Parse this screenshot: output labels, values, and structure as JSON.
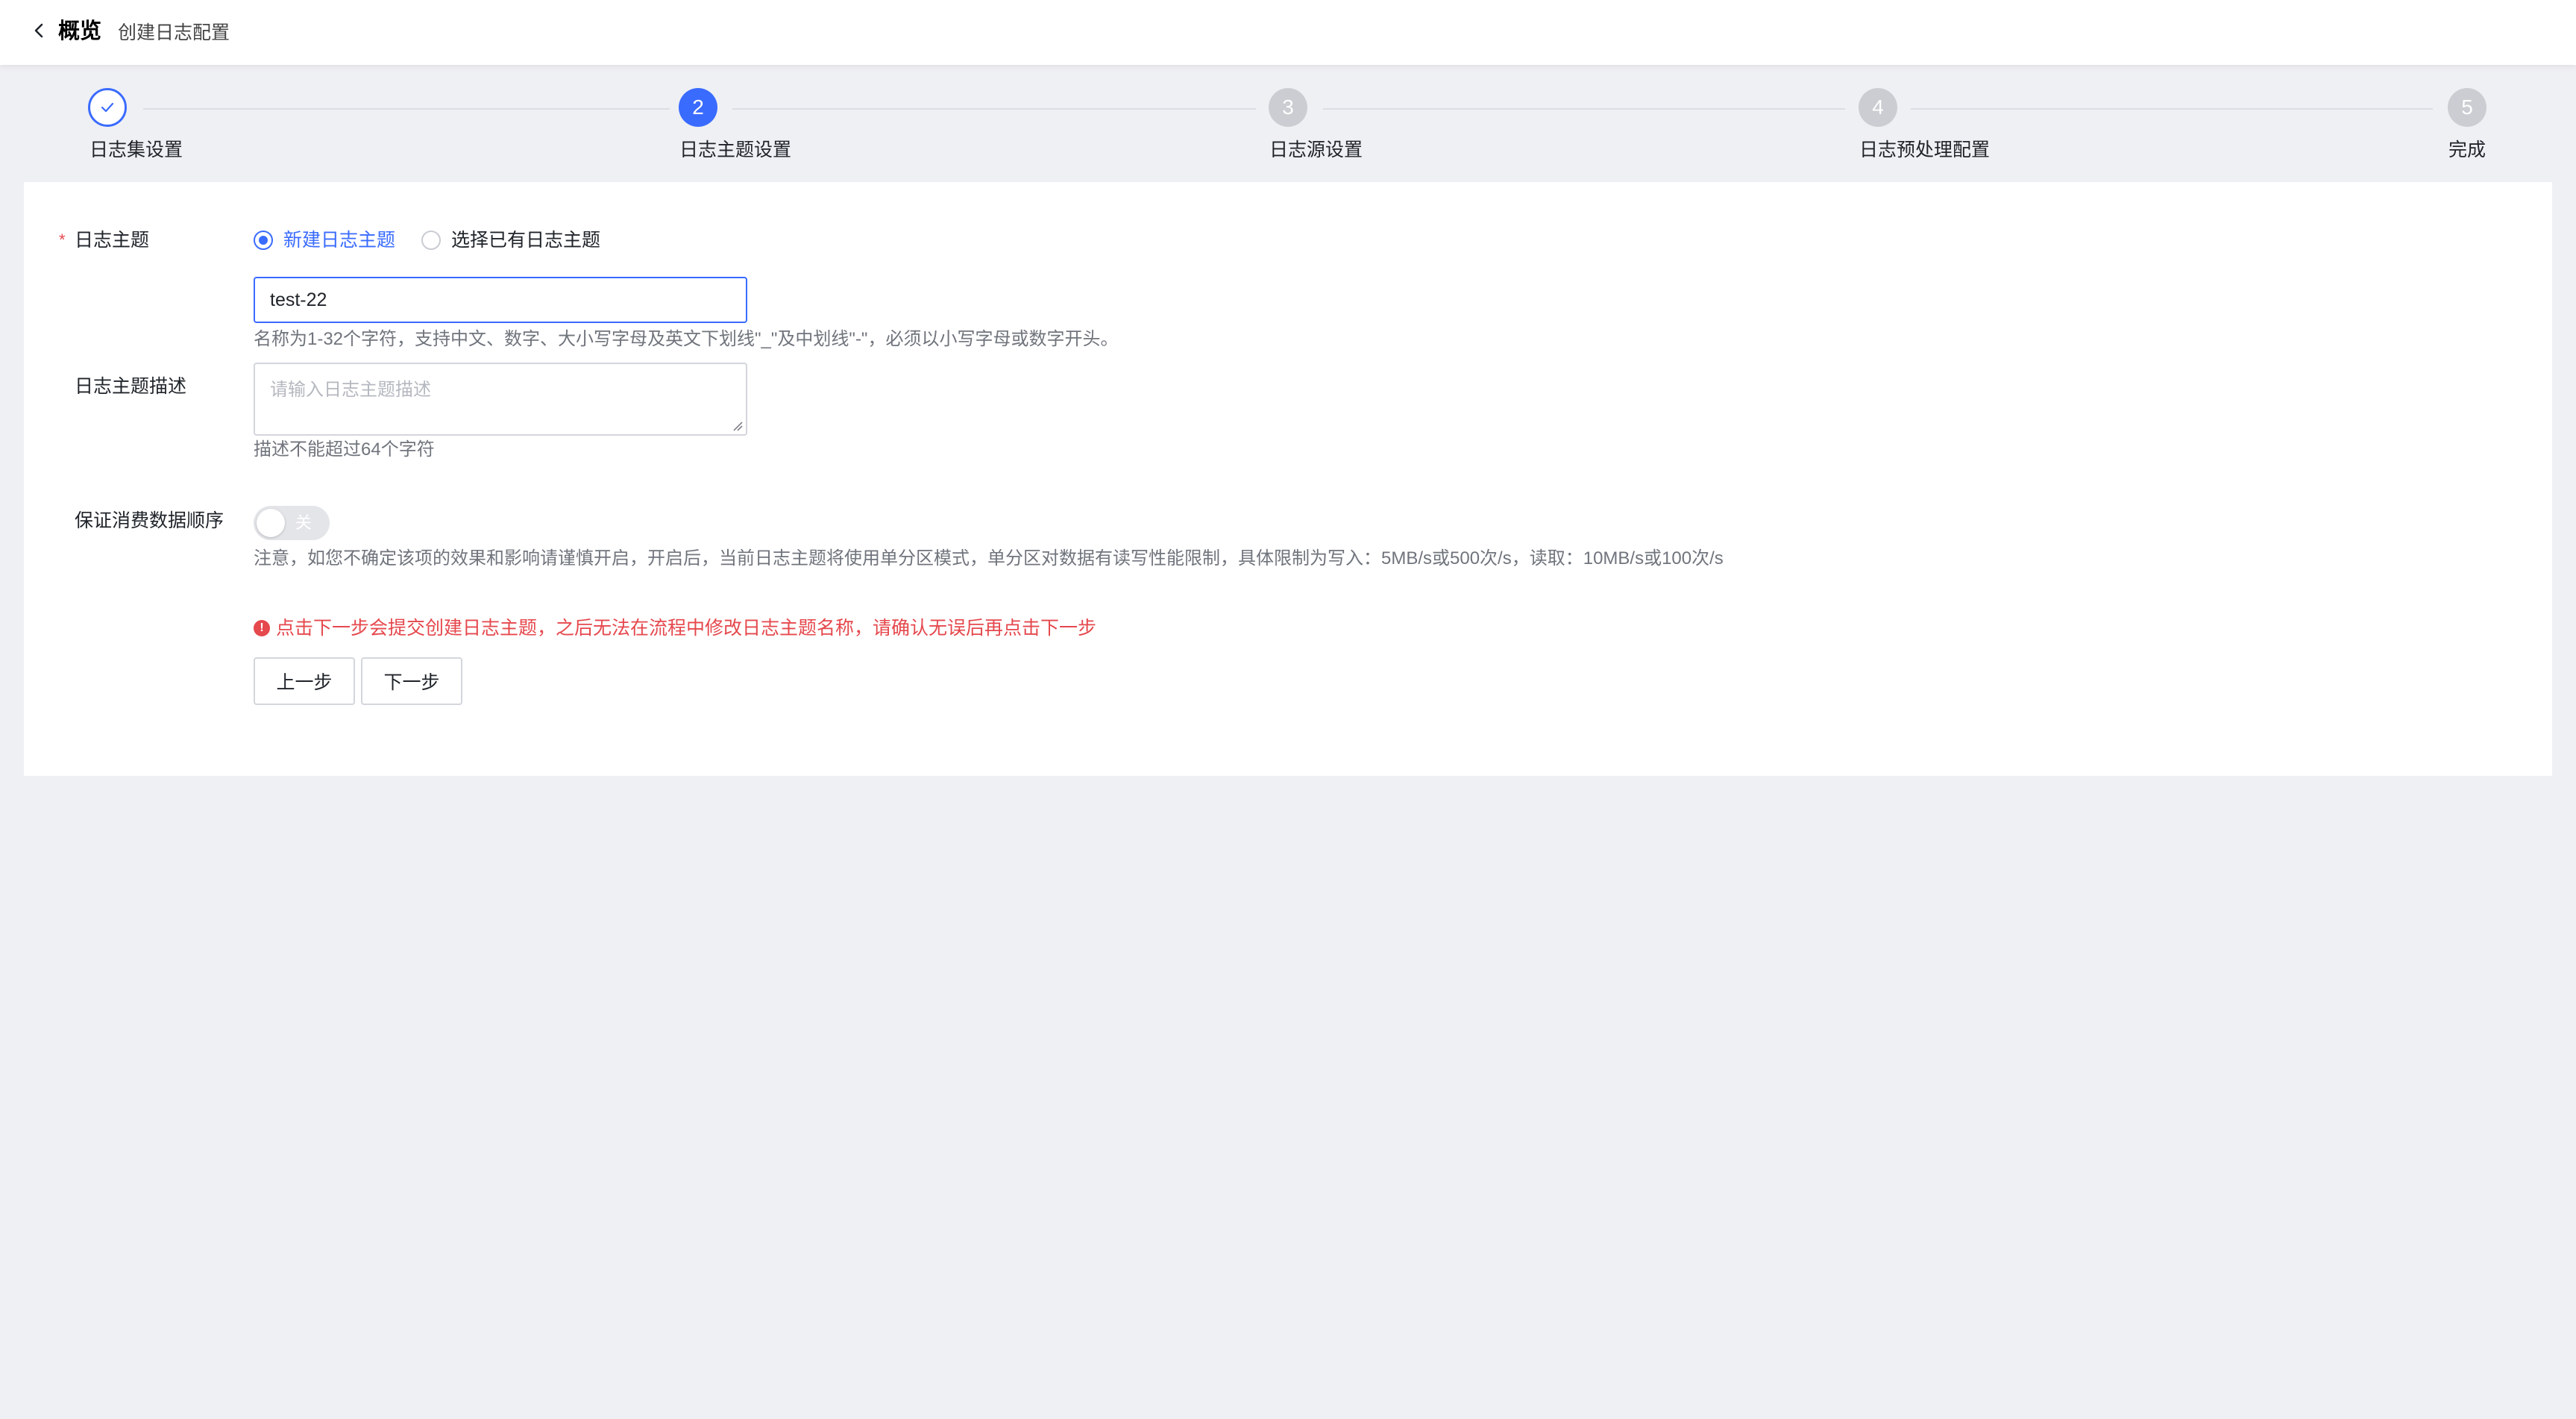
{
  "header": {
    "title": "概览",
    "subtitle": "创建日志配置"
  },
  "steps": [
    {
      "number": "1",
      "label": "日志集设置",
      "status": "done"
    },
    {
      "number": "2",
      "label": "日志主题设置",
      "status": "active"
    },
    {
      "number": "3",
      "label": "日志源设置",
      "status": "pending"
    },
    {
      "number": "4",
      "label": "日志预处理配置",
      "status": "pending"
    },
    {
      "number": "5",
      "label": "完成",
      "status": "pending"
    }
  ],
  "form": {
    "topic": {
      "required_mark": "*",
      "label": "日志主题",
      "options": [
        {
          "label": "新建日志主题",
          "checked": true
        },
        {
          "label": "选择已有日志主题",
          "checked": false
        }
      ],
      "value": "test-22",
      "hint": "名称为1-32个字符，支持中文、数字、大小写字母及英文下划线\"_\"及中划线\"-\"，必须以小写字母或数字开头。"
    },
    "description": {
      "label": "日志主题描述",
      "placeholder": "请输入日志主题描述",
      "hint": "描述不能超过64个字符"
    },
    "order": {
      "label": "保证消费数据顺序",
      "toggle_text": "关",
      "toggle_on": false,
      "hint": "注意，如您不确定该项的效果和影响请谨慎开启，开启后，当前日志主题将使用单分区模式，单分区对数据有读写性能限制，具体限制为写入：5MB/s或500次/s，读取：10MB/s或100次/s"
    },
    "warning": "点击下一步会提交创建日志主题，之后无法在流程中修改日志主题名称，请确认无误后再点击下一步",
    "buttons": {
      "prev": "上一步",
      "next": "下一步"
    }
  },
  "colors": {
    "accent": "#3a6bff",
    "error": "#e5484d",
    "background": "#eff0f4"
  }
}
